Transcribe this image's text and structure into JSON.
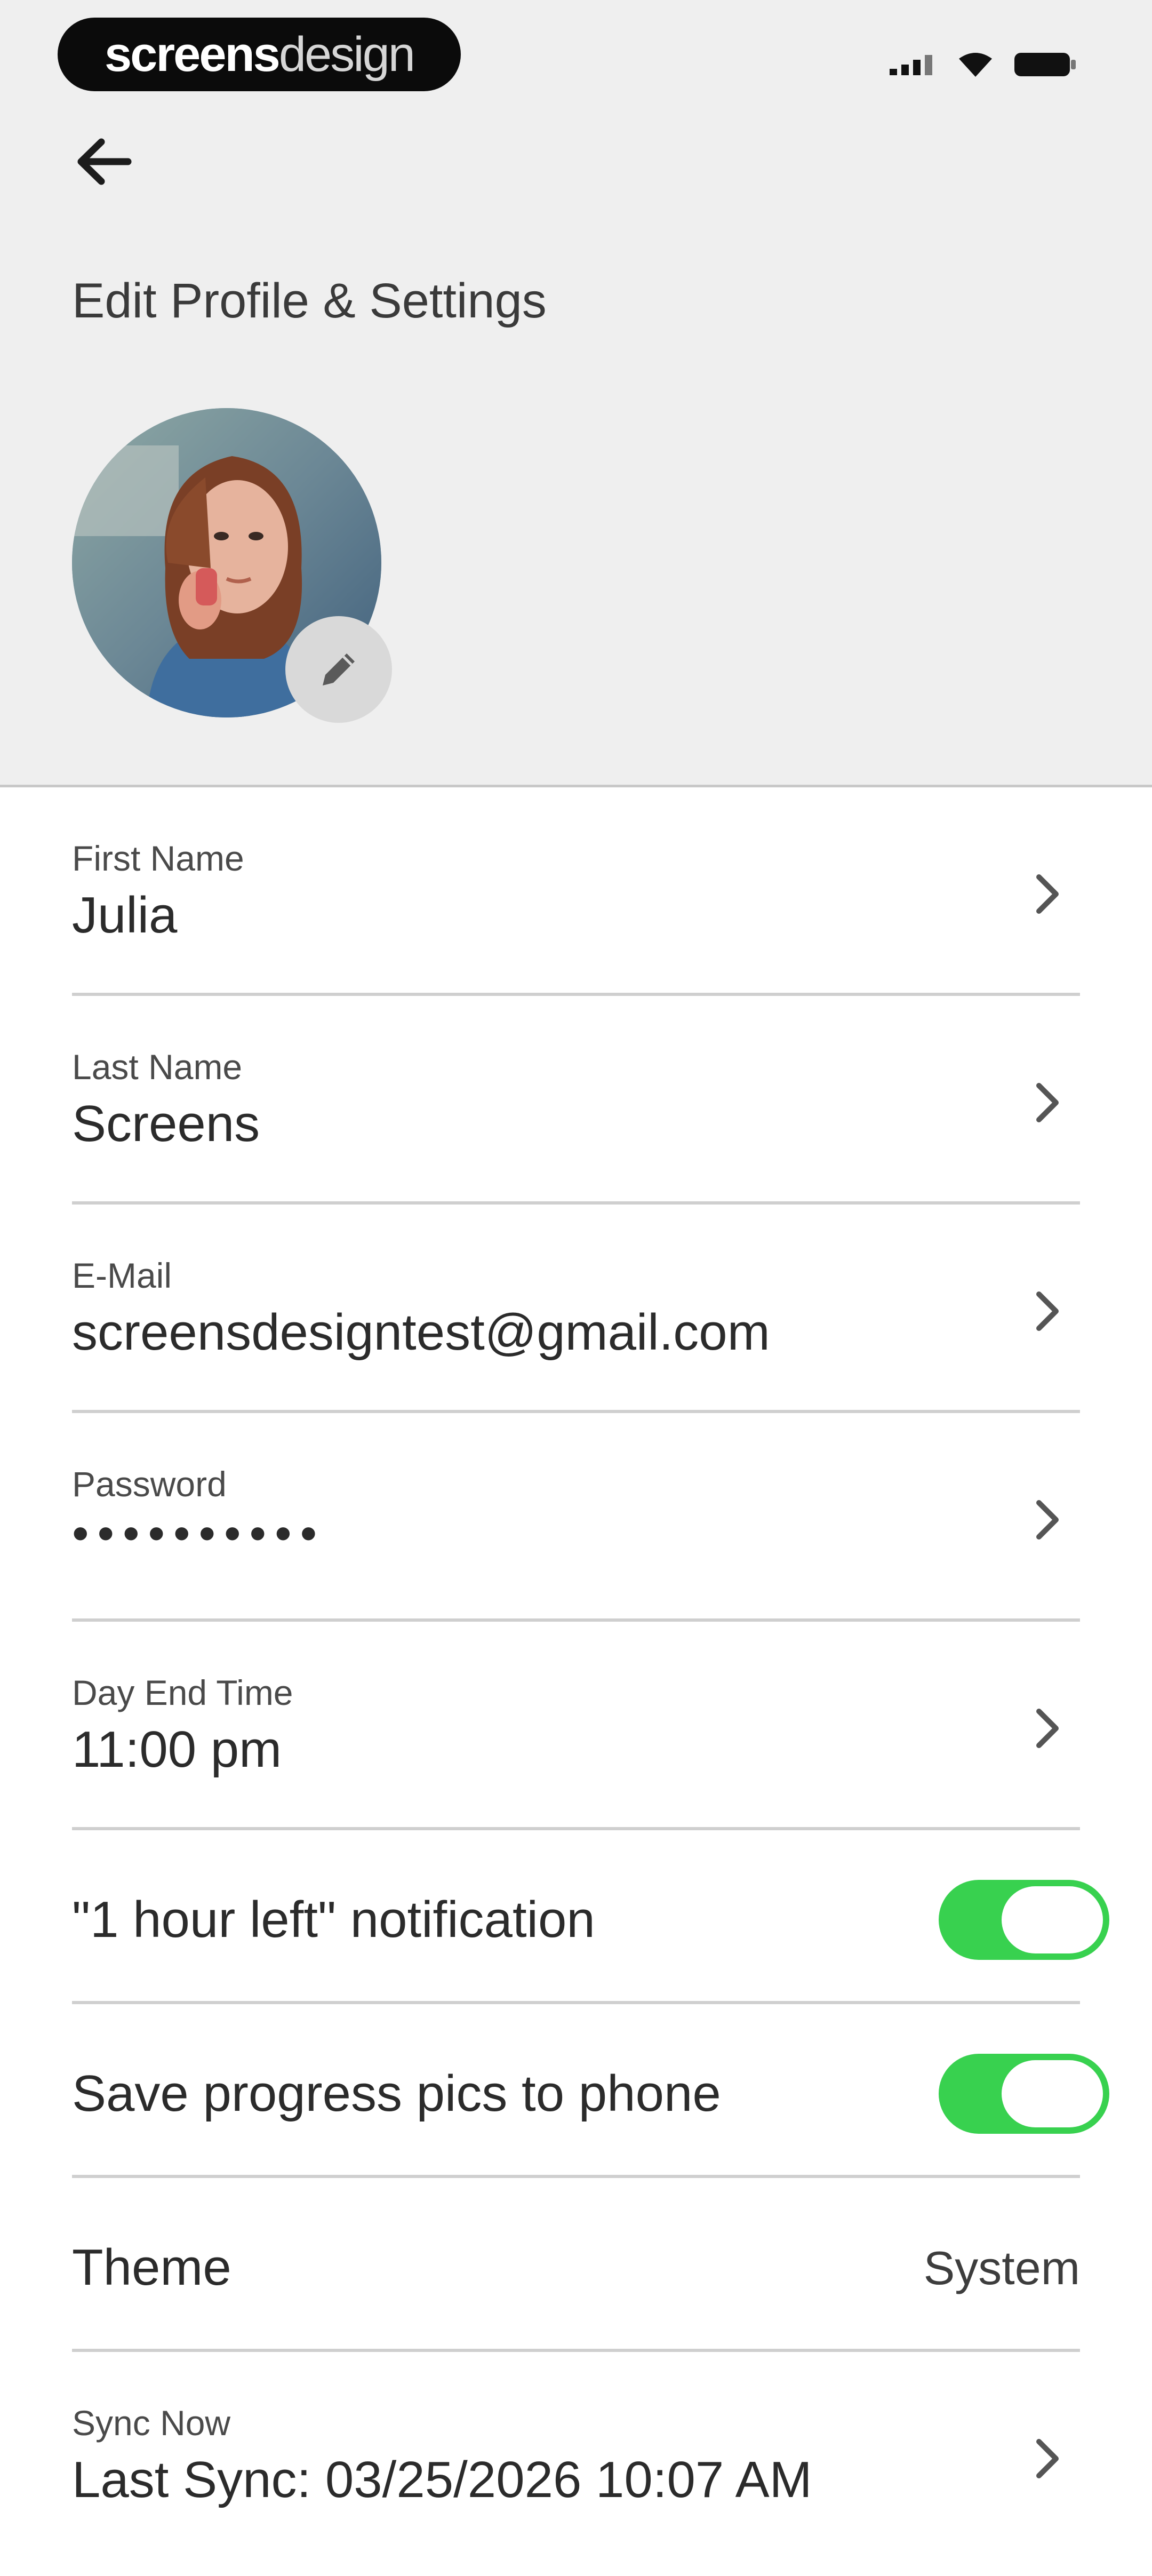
{
  "status_bar": {
    "brand_bold": "screens",
    "brand_light": "design",
    "icons": [
      "signal-icon",
      "wifi-icon",
      "battery-icon"
    ]
  },
  "header": {
    "back_icon": "arrow-left-icon",
    "title": "Edit Profile & Settings",
    "edit_icon": "pencil-icon"
  },
  "fields": [
    {
      "label": "First Name",
      "value": "Julia"
    },
    {
      "label": "Last Name",
      "value": "Screens"
    },
    {
      "label": "E-Mail",
      "value": "screensdesigntest@gmail.com"
    },
    {
      "label": "Password",
      "value": "••••••••••"
    },
    {
      "label": "Day End Time",
      "value": "11:00 pm"
    }
  ],
  "toggles": [
    {
      "label": "\"1 hour left\" notification",
      "on": true
    },
    {
      "label": "Save progress pics to phone",
      "on": true
    }
  ],
  "theme": {
    "label": "Theme",
    "value": "System"
  },
  "sync": {
    "label": "Sync Now",
    "value": "Last Sync: 03/25/2026 10:07 AM"
  },
  "colors": {
    "header_bg": "#efefef",
    "toggle_on": "#38d14f",
    "divider": "#cfcfcf",
    "text": "#2b2b2b"
  }
}
